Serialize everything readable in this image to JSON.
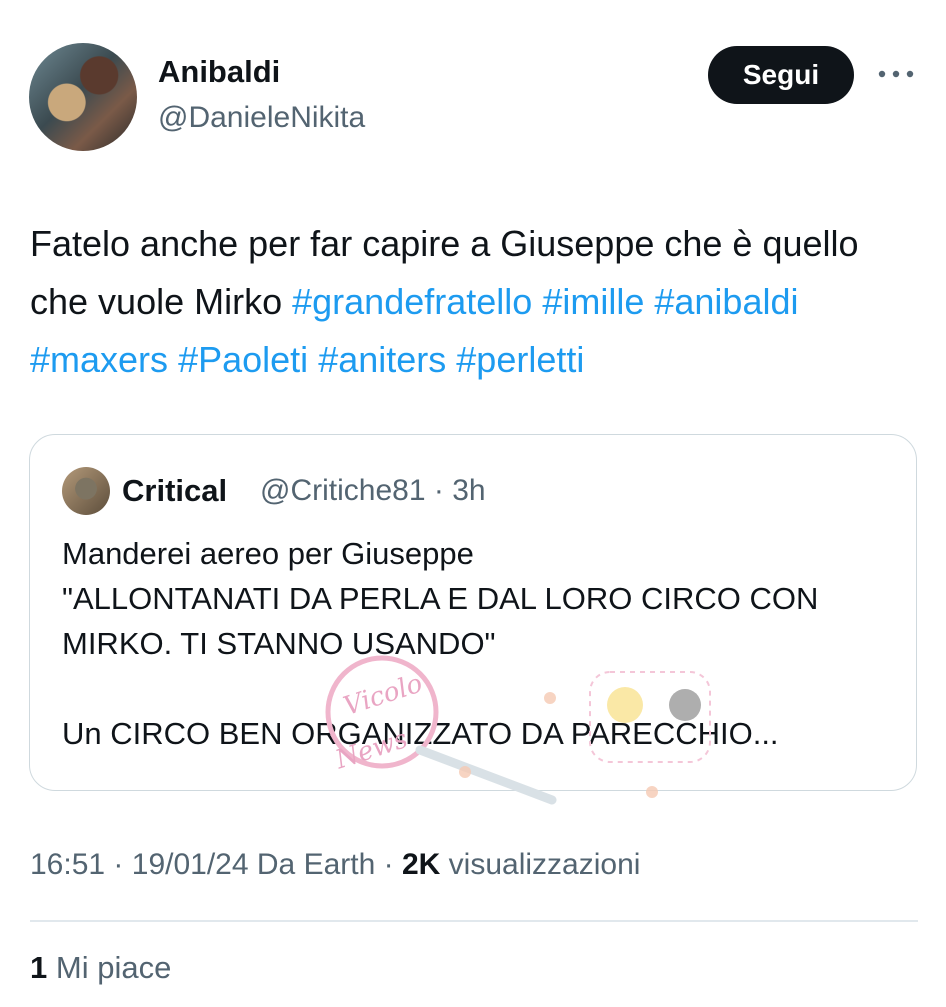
{
  "author": {
    "display_name": "Anibaldi",
    "handle": "@DanieleNikita"
  },
  "actions": {
    "follow_label": "Segui",
    "more_icon": "more-horizontal-icon"
  },
  "tweet": {
    "text_plain": "Fatelo anche per far capire a Giuseppe che è quello che vuole Mirko",
    "hashtags": [
      "#grandefratello",
      "#imille",
      "#anibaldi",
      "#maxers",
      "#Paoleti",
      "#aniters",
      "#perletti"
    ]
  },
  "quote": {
    "display_name": "Critical",
    "handle": "@Critiche81",
    "separator": "·",
    "time": "3h",
    "text": "Manderei aereo per Giuseppe\n\"ALLONTANATI DA PERLA E DAL LORO CIRCO CON MIRKO. TI STANNO USANDO\"\n\nUn CIRCO BEN ORGANIZZATO DA PARECCHIO..."
  },
  "watermark": {
    "text_1": "Vicolo",
    "text_2": "News"
  },
  "meta": {
    "time": "16:51",
    "sep1": "·",
    "date": "19/01/24",
    "source": "Da Earth",
    "sep2": "·",
    "views_count": "2K",
    "views_label": "visualizzazioni"
  },
  "engagement": {
    "likes_count": "1",
    "likes_label": "Mi piace"
  },
  "colors": {
    "text": "#0f1419",
    "secondary": "#536471",
    "link": "#1d9bf0",
    "button_bg": "#0f1419",
    "border": "#cfd9de"
  }
}
